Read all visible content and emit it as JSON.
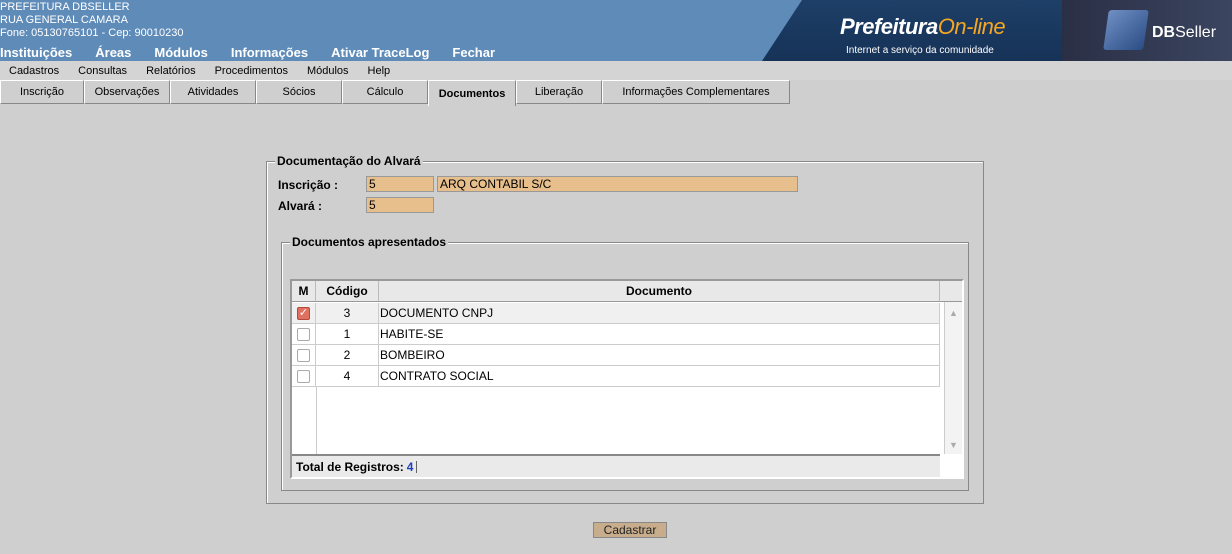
{
  "header": {
    "line1": "PREFEITURA DBSELLER",
    "line2": "RUA GENERAL CAMARA",
    "line3": "Fone: 05130765101  -  Cep: 90010230",
    "brand_main": "Prefeitura",
    "brand_online": "On-line",
    "tagline": "Internet a serviço da comunidade",
    "db_bold": "DB",
    "db_rest": "Seller"
  },
  "mainmenu": [
    "Instituições",
    "Áreas",
    "Módulos",
    "Informações",
    "Ativar TraceLog",
    "Fechar"
  ],
  "submenu": [
    "Cadastros",
    "Consultas",
    "Relatórios",
    "Procedimentos",
    "Módulos",
    "Help"
  ],
  "tabs": [
    "Inscrição",
    "Observações",
    "Atividades",
    "Sócios",
    "Cálculo",
    "Documentos",
    "Liberação",
    "Informações Complementares"
  ],
  "form": {
    "legend": "Documentação do Alvará",
    "inscricao_label": "Inscrição :",
    "inscricao_value": "5",
    "inscricao_name": "ARQ CONTABIL S/C",
    "alvara_label": "Alvará :",
    "alvara_value": "5"
  },
  "docs": {
    "legend": "Documentos apresentados",
    "headers": {
      "m": "M",
      "codigo": "Código",
      "documento": "Documento"
    },
    "rows": [
      {
        "checked": true,
        "codigo": "3",
        "documento": "DOCUMENTO CNPJ"
      },
      {
        "checked": false,
        "codigo": "1",
        "documento": "HABITE-SE"
      },
      {
        "checked": false,
        "codigo": "2",
        "documento": "BOMBEIRO"
      },
      {
        "checked": false,
        "codigo": "4",
        "documento": "CONTRATO SOCIAL"
      }
    ],
    "total_label": "Total de Registros:",
    "total_value": "4"
  },
  "submit_label": "Cadastrar"
}
